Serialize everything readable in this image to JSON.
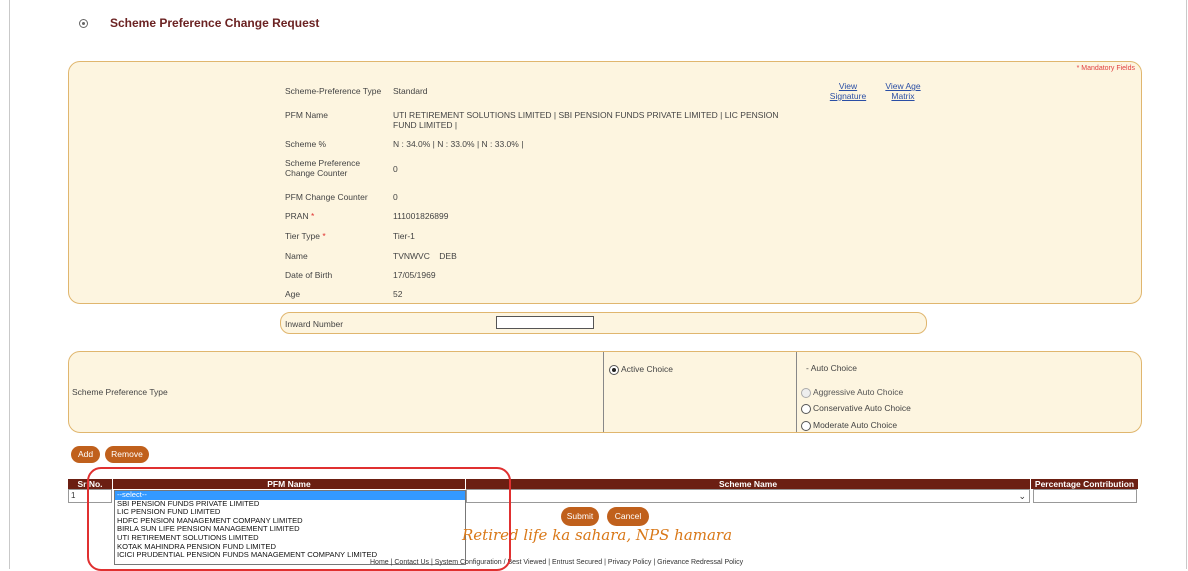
{
  "page": {
    "title": "Scheme Preference Change Request",
    "mandatory_note": "* Mandatory Fields"
  },
  "details": {
    "scheme_pref_type_label": "Scheme-Preference Type",
    "scheme_pref_type_value": "Standard",
    "pfm_name_label": "PFM Name",
    "pfm_name_value": "UTI RETIREMENT SOLUTIONS LIMITED  |  SBI PENSION FUNDS PRIVATE LIMITED  |  LIC PENSION FUND LIMITED  |",
    "scheme_pct_label": "Scheme %",
    "scheme_pct_value": "N : 34.0%  |  N : 33.0%  |  N : 33.0%  |",
    "spc_counter_label": "Scheme Preference Change Counter",
    "spc_counter_value": "0",
    "pfm_counter_label": "PFM Change Counter",
    "pfm_counter_value": "0",
    "pran_label": "PRAN",
    "pran_value": "111001826899",
    "tier_label": "Tier Type",
    "tier_value": "Tier-1",
    "name_label": "Name",
    "name_value": "TVNWVC    DEB",
    "dob_label": "Date of Birth",
    "dob_value": "17/05/1969",
    "age_label": "Age",
    "age_value": "52",
    "required_marker": "*",
    "view_signature": "View Signature",
    "view_age_matrix": "View Age Matrix"
  },
  "inward": {
    "label": "Inward Number",
    "value": ""
  },
  "choice": {
    "label": "Scheme Preference Type",
    "active": "Active Choice",
    "auto": "- Auto Choice",
    "aggressive": "Aggressive Auto Choice",
    "conservative": "Conservative Auto Choice",
    "moderate": "Moderate Auto Choice"
  },
  "actions": {
    "add": "Add",
    "remove": "Remove",
    "submit": "Submit",
    "cancel": "Cancel"
  },
  "grid": {
    "headers": [
      "Sr No.",
      "PFM Name",
      "Scheme Name",
      "Percentage Contribution"
    ],
    "row_no": "1",
    "options": [
      "--select--",
      "SBI PENSION FUNDS PRIVATE LIMITED",
      "LIC PENSION FUND LIMITED",
      "HDFC PENSION MANAGEMENT COMPANY LIMITED",
      "BIRLA SUN LIFE PENSION MANAGEMENT LIMITED",
      "UTI RETIREMENT SOLUTIONS LIMITED",
      "KOTAK MAHINDRA PENSION FUND LIMITED",
      "ICICI PRUDENTIAL PENSION FUNDS MANAGEMENT COMPANY LIMITED"
    ]
  },
  "tagline": "Retired life ka sahara, NPS hamara",
  "footer": "Home | Contact Us | System Configuration / Best Viewed | Entrust Secured | Privacy Policy | Grievance Redressal Policy",
  "colors": {
    "header_bg": "#6b1f12",
    "button": "#c0601c",
    "panel_bg": "#fdf5e0",
    "highlight": "#e03030"
  }
}
